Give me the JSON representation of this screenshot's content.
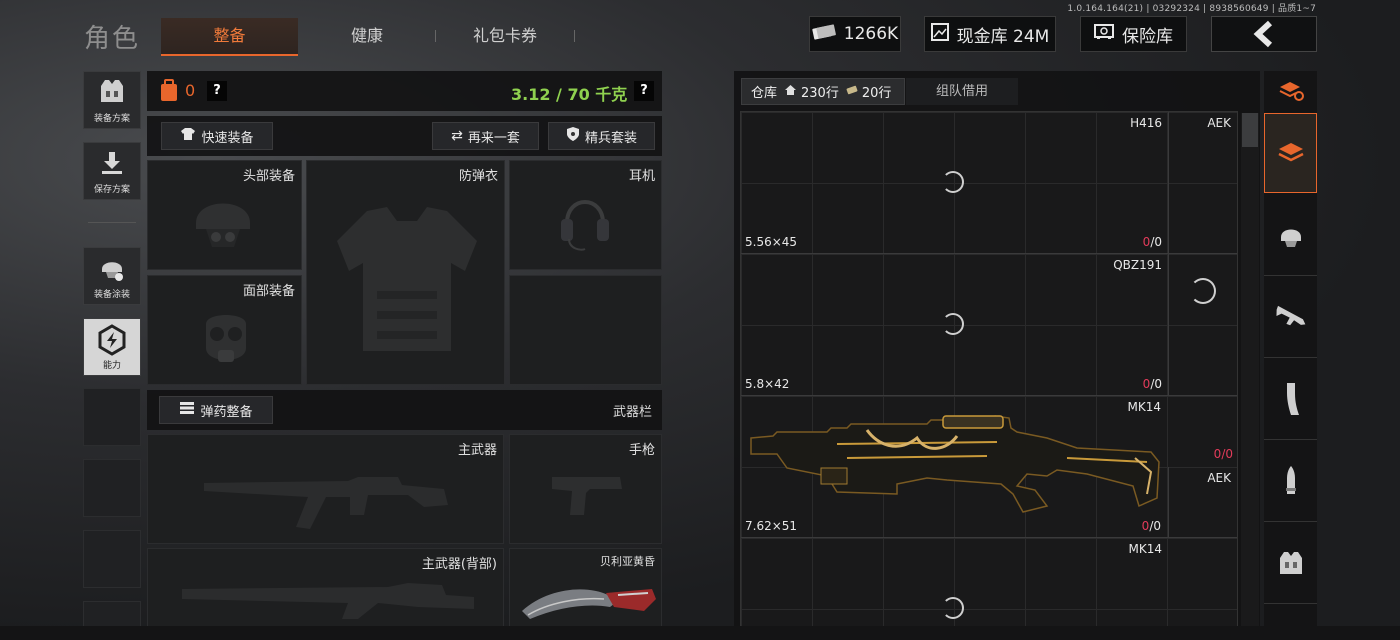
{
  "build": "1.0.164.164(21) | 03292324 | 8938560649 | 品质1~7",
  "header": {
    "role_title": "角色",
    "tabs": [
      {
        "label": "整备",
        "active": true
      },
      {
        "label": "健康",
        "active": false
      },
      {
        "label": "礼包卡券",
        "active": false
      }
    ],
    "currency": "1266K",
    "cash_vault": "现金库 24M",
    "safe": "保险库"
  },
  "sidebar": [
    {
      "label": "装备方案",
      "icon": "vest-icon"
    },
    {
      "label": "保存方案",
      "icon": "download-icon"
    },
    {
      "label": "装备涂装",
      "icon": "helmet-paint-icon"
    },
    {
      "label": "能力",
      "icon": "ability-icon"
    }
  ],
  "loadout": {
    "backpack_count": "0",
    "weight": "3.12 / 70 千克",
    "quick_equip": "快速装备",
    "again": "再来一套",
    "elite": "精兵套装",
    "slots": {
      "head": "头部装备",
      "armor": "防弹衣",
      "earphone": "耳机",
      "face": "面部装备"
    },
    "ammo_btn": "弹药整备",
    "weapon_bar": "武器栏",
    "primary": "主武器",
    "pistol": "手枪",
    "primary_back": "主武器(背部)",
    "melee": "贝利亚黄昏"
  },
  "warehouse": {
    "tab_label": "仓库",
    "rows_a": "230行",
    "rows_b": "20行",
    "team_borrow": "组队借用",
    "items": [
      {
        "name": "H416",
        "caliber": "5.56×45",
        "count_current": "0",
        "count_total": "/0"
      },
      {
        "name": "AEK"
      },
      {
        "name": "QBZ191",
        "caliber": "5.8×42",
        "count_current": "0",
        "count_total": "/0"
      },
      {
        "name": "MK14",
        "caliber": "7.62×51",
        "count_current": "0",
        "count_total": "/0"
      },
      {
        "name": "AEK",
        "count_current": "0",
        "count_total": "/0"
      },
      {
        "name": "MK14"
      }
    ]
  },
  "colors": {
    "accent": "#e8662c",
    "weight_green": "#8fd14f",
    "count_red": "#e23b5a"
  }
}
